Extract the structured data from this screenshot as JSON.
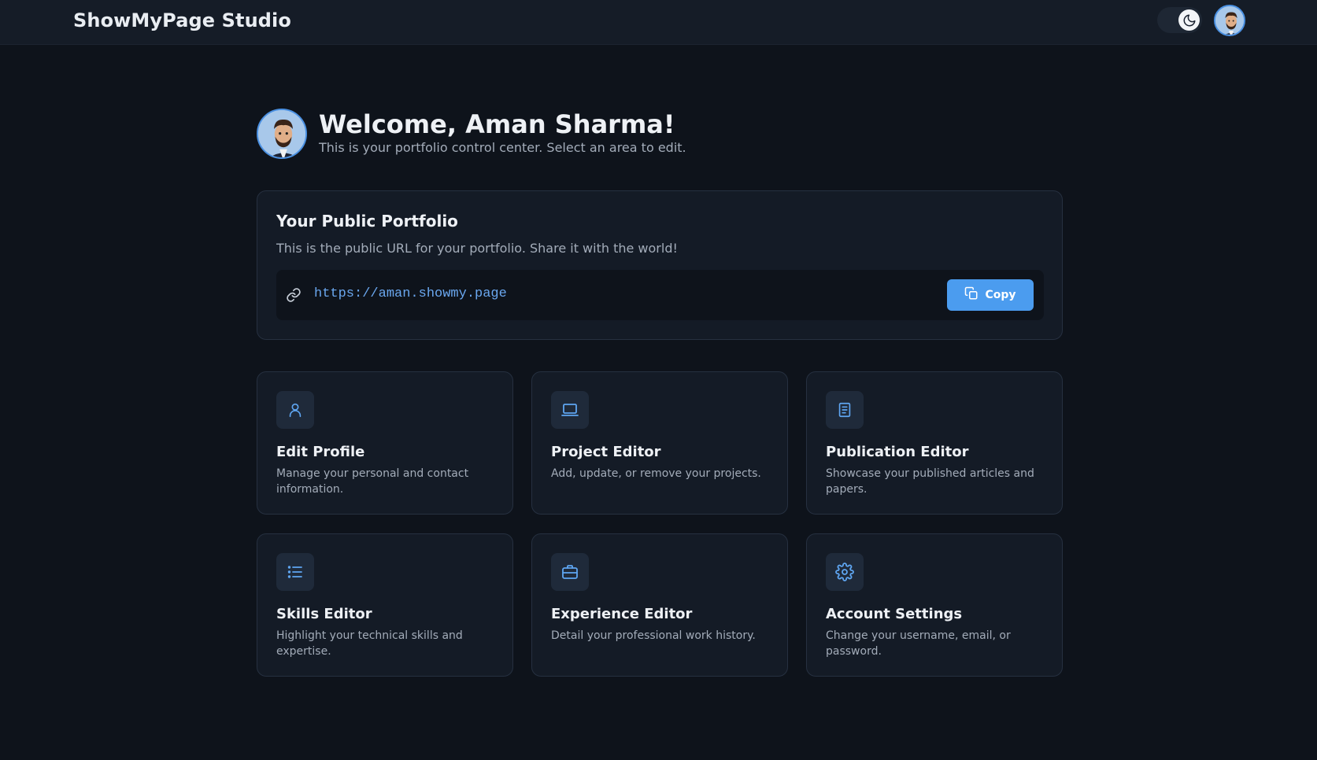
{
  "header": {
    "brand": "ShowMyPage Studio",
    "theme_icon": "moon-icon",
    "avatar_icon": "user-avatar"
  },
  "welcome": {
    "title": "Welcome, Aman Sharma!",
    "subtitle": "This is your portfolio control center. Select an area to edit."
  },
  "portfolio": {
    "title": "Your Public Portfolio",
    "description": "This is the public URL for your portfolio. Share it with the world!",
    "url": "https://aman.showmy.page",
    "copy_label": "Copy"
  },
  "tiles": [
    {
      "title": "Edit Profile",
      "description": "Manage your personal and contact information.",
      "icon": "user-icon"
    },
    {
      "title": "Project Editor",
      "description": "Add, update, or remove your projects.",
      "icon": "laptop-icon"
    },
    {
      "title": "Publication Editor",
      "description": "Showcase your published articles and papers.",
      "icon": "document-icon"
    },
    {
      "title": "Skills Editor",
      "description": "Highlight your technical skills and expertise.",
      "icon": "list-icon"
    },
    {
      "title": "Experience Editor",
      "description": "Detail your professional work history.",
      "icon": "briefcase-icon"
    },
    {
      "title": "Account Settings",
      "description": "Change your username, email, or password.",
      "icon": "gear-icon"
    }
  ],
  "colors": {
    "accent": "#4b9cef",
    "background": "#0e131b",
    "card": "#141b26",
    "link": "#6aa7ef"
  }
}
